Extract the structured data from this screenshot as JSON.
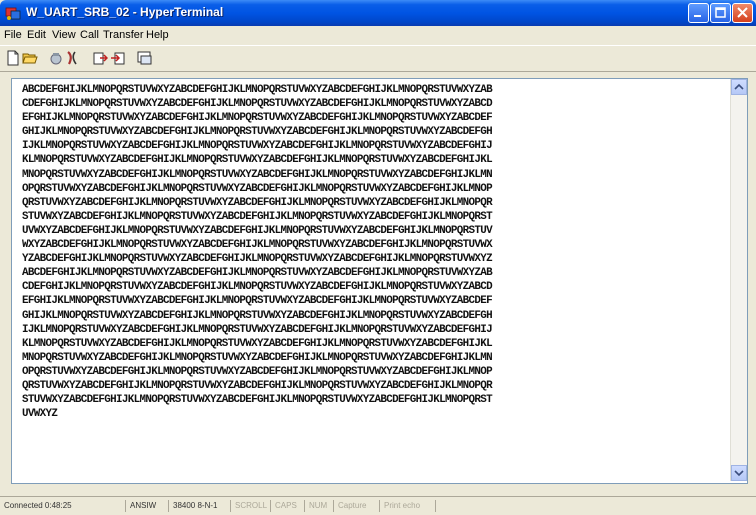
{
  "window": {
    "title": "W_UART_SRB_02 - HyperTerminal"
  },
  "menu": [
    "File",
    "Edit",
    "View",
    "Call",
    "Transfer",
    "Help"
  ],
  "toolbar_icons": [
    "new-icon",
    "open-icon",
    "call-icon",
    "disconnect-icon",
    "send-icon",
    "receive-icon",
    "properties-icon"
  ],
  "terminal": {
    "lines": [
      "ABCDEFGHIJKLMNOPQRSTUVWXYZABCDEFGHIJKLMNOPQRSTUVWXYZABCDEFGHIJKLMNOPQRSTUVWXYZAB",
      "CDEFGHIJKLMNOPQRSTUVWXYZABCDEFGHIJKLMNOPQRSTUVWXYZABCDEFGHIJKLMNOPQRSTUVWXYZABCD",
      "EFGHIJKLMNOPQRSTUVWXYZABCDEFGHIJKLMNOPQRSTUVWXYZABCDEFGHIJKLMNOPQRSTUVWXYZABCDEF",
      "GHIJKLMNOPQRSTUVWXYZABCDEFGHIJKLMNOPQRSTUVWXYZABCDEFGHIJKLMNOPQRSTUVWXYZABCDEFGH",
      "IJKLMNOPQRSTUVWXYZABCDEFGHIJKLMNOPQRSTUVWXYZABCDEFGHIJKLMNOPQRSTUVWXYZABCDEFGHIJ",
      "KLMNOPQRSTUVWXYZABCDEFGHIJKLMNOPQRSTUVWXYZABCDEFGHIJKLMNOPQRSTUVWXYZABCDEFGHIJKL",
      "MNOPQRSTUVWXYZABCDEFGHIJKLMNOPQRSTUVWXYZABCDEFGHIJKLMNOPQRSTUVWXYZABCDEFGHIJKLMN",
      "OPQRSTUVWXYZABCDEFGHIJKLMNOPQRSTUVWXYZABCDEFGHIJKLMNOPQRSTUVWXYZABCDEFGHIJKLMNOP",
      "QRSTUVWXYZABCDEFGHIJKLMNOPQRSTUVWXYZABCDEFGHIJKLMNOPQRSTUVWXYZABCDEFGHIJKLMNOPQR",
      "STUVWXYZABCDEFGHIJKLMNOPQRSTUVWXYZABCDEFGHIJKLMNOPQRSTUVWXYZABCDEFGHIJKLMNOPQRST",
      "UVWXYZABCDEFGHIJKLMNOPQRSTUVWXYZABCDEFGHIJKLMNOPQRSTUVWXYZABCDEFGHIJKLMNOPQRSTUV",
      "WXYZABCDEFGHIJKLMNOPQRSTUVWXYZABCDEFGHIJKLMNOPQRSTUVWXYZABCDEFGHIJKLMNOPQRSTUVWX",
      "YZABCDEFGHIJKLMNOPQRSTUVWXYZABCDEFGHIJKLMNOPQRSTUVWXYZABCDEFGHIJKLMNOPQRSTUVWXYZ",
      "ABCDEFGHIJKLMNOPQRSTUVWXYZABCDEFGHIJKLMNOPQRSTUVWXYZABCDEFGHIJKLMNOPQRSTUVWXYZAB",
      "CDEFGHIJKLMNOPQRSTUVWXYZABCDEFGHIJKLMNOPQRSTUVWXYZABCDEFGHIJKLMNOPQRSTUVWXYZABCD",
      "EFGHIJKLMNOPQRSTUVWXYZABCDEFGHIJKLMNOPQRSTUVWXYZABCDEFGHIJKLMNOPQRSTUVWXYZABCDEF",
      "GHIJKLMNOPQRSTUVWXYZABCDEFGHIJKLMNOPQRSTUVWXYZABCDEFGHIJKLMNOPQRSTUVWXYZABCDEFGH",
      "IJKLMNOPQRSTUVWXYZABCDEFGHIJKLMNOPQRSTUVWXYZABCDEFGHIJKLMNOPQRSTUVWXYZABCDEFGHIJ",
      "KLMNOPQRSTUVWXYZABCDEFGHIJKLMNOPQRSTUVWXYZABCDEFGHIJKLMNOPQRSTUVWXYZABCDEFGHIJKL",
      "MNOPQRSTUVWXYZABCDEFGHIJKLMNOPQRSTUVWXYZABCDEFGHIJKLMNOPQRSTUVWXYZABCDEFGHIJKLMN",
      "OPQRSTUVWXYZABCDEFGHIJKLMNOPQRSTUVWXYZABCDEFGHIJKLMNOPQRSTUVWXYZABCDEFGHIJKLMNOP",
      "QRSTUVWXYZABCDEFGHIJKLMNOPQRSTUVWXYZABCDEFGHIJKLMNOPQRSTUVWXYZABCDEFGHIJKLMNOPQR",
      "STUVWXYZABCDEFGHIJKLMNOPQRSTUVWXYZABCDEFGHIJKLMNOPQRSTUVWXYZABCDEFGHIJKLMNOPQRST",
      "UVWXYZ"
    ]
  },
  "status": {
    "connected": "Connected 0:48:25",
    "emulation": "ANSIW",
    "settings": "38400 8-N-1",
    "scroll": "SCROLL",
    "caps": "CAPS",
    "num": "NUM",
    "capture": "Capture",
    "print_echo": "Print echo"
  },
  "colors": {
    "title_bar": "#0054e3",
    "chrome": "#ece9d8",
    "terminal_bg": "#ffffff"
  }
}
